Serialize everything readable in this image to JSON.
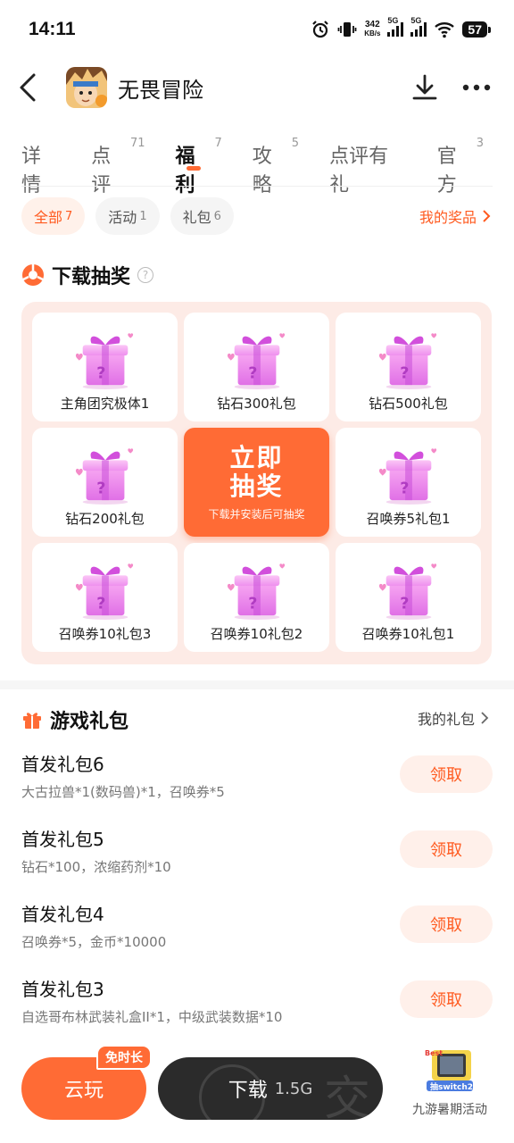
{
  "status_bar": {
    "time": "14:11",
    "net_speed_value": "342",
    "net_speed_unit": "KB/s",
    "signal1_label": "5G",
    "signal2_label": "5G",
    "battery": "57"
  },
  "header": {
    "title": "无畏冒险"
  },
  "tabs": [
    {
      "label": "详情",
      "count": ""
    },
    {
      "label": "点评",
      "count": "71"
    },
    {
      "label": "福利",
      "count": "7"
    },
    {
      "label": "攻略",
      "count": "5"
    },
    {
      "label": "点评有礼",
      "count": ""
    },
    {
      "label": "官方",
      "count": "3"
    }
  ],
  "filters": {
    "chips": [
      {
        "label": "全部",
        "count": "7"
      },
      {
        "label": "活动",
        "count": "1"
      },
      {
        "label": "礼包",
        "count": "6"
      }
    ],
    "my_prizes": "我的奖品"
  },
  "lottery": {
    "title": "下载抽奖",
    "help": "?",
    "prizes": [
      "主角团究极体1",
      "钻石300礼包",
      "钻石500礼包",
      "钻石200礼包",
      "召唤券5礼包1",
      "召唤券10礼包3",
      "召唤券10礼包2",
      "召唤券10礼包1"
    ],
    "draw_button_line1": "立即",
    "draw_button_line2": "抽奖",
    "draw_button_hint": "下载并安装后可抽奖"
  },
  "game_gifts": {
    "title": "游戏礼包",
    "my_gifts": "我的礼包",
    "claim_label": "领取",
    "packs": [
      {
        "title": "首发礼包6",
        "desc": "大古拉兽*1(数码兽)*1，召唤券*5"
      },
      {
        "title": "首发礼包5",
        "desc": "钻石*100，浓缩药剂*10"
      },
      {
        "title": "首发礼包4",
        "desc": "召唤券*5，金币*10000"
      },
      {
        "title": "首发礼包3",
        "desc": "自选哥布林武装礼盒II*1，中级武装数据*10"
      }
    ]
  },
  "bottom_bar": {
    "cloud_play": "云玩",
    "free_time_tag": "免时长",
    "download_label": "下载",
    "download_size": "1.5G",
    "watermark": "交",
    "promo_text": "九游暑期活动"
  },
  "colors": {
    "accent": "#ff6b35",
    "accent_text": "#ff5a1f",
    "lottery_bg": "#fdebe6",
    "dark_button": "#2b2b2b"
  },
  "icons": {
    "back": "chevron-left-icon",
    "download": "download-icon",
    "more": "more-dots-icon",
    "lottery": "lottery-wheel-icon",
    "gift": "gift-icon"
  }
}
